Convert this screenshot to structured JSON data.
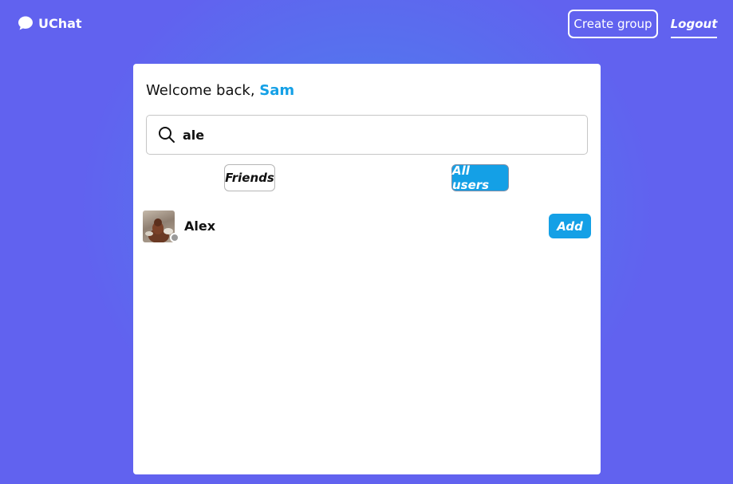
{
  "app": {
    "name": "UChat",
    "logo_icon": "chat-bubble-icon"
  },
  "header": {
    "create_group_label": "Create group",
    "logout_label": "Logout"
  },
  "welcome": {
    "prefix": "Welcome back, ",
    "user_name": "Sam"
  },
  "search": {
    "value": "ale",
    "icon": "search-icon"
  },
  "tabs": [
    {
      "label": "Friends",
      "active": false
    },
    {
      "label": "All users",
      "active": true
    }
  ],
  "users": [
    {
      "name": "Alex",
      "status": "offline",
      "action_label": "Add"
    }
  ],
  "colors": {
    "accent": "#14a0e6",
    "background": "#6262ef",
    "status_offline": "#9a9a9a"
  }
}
